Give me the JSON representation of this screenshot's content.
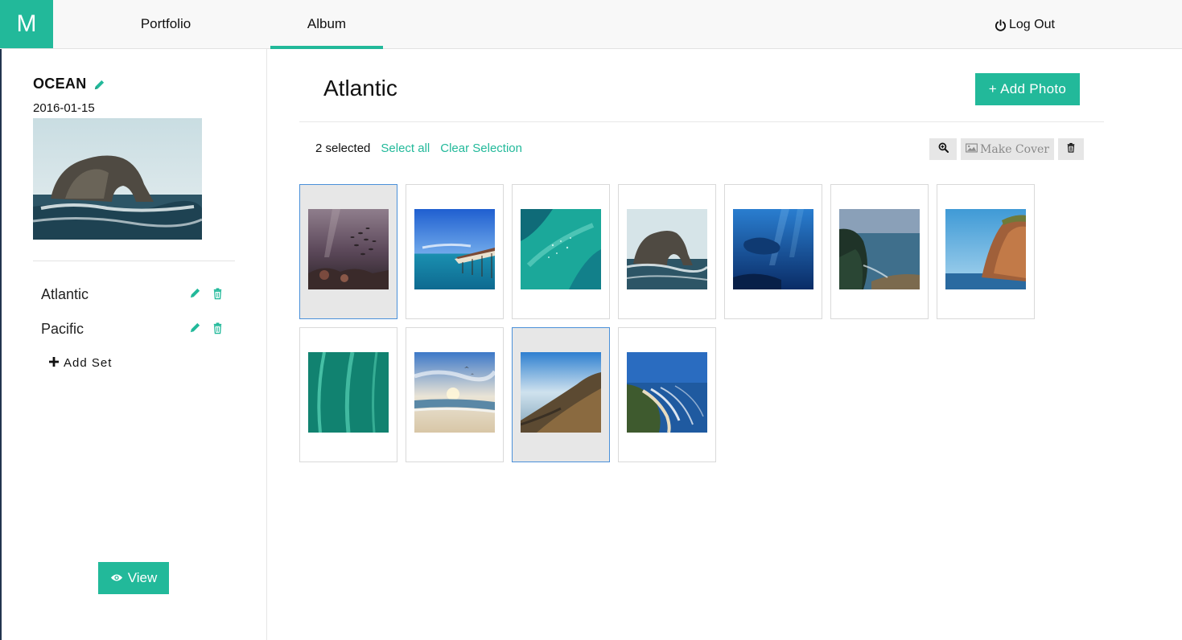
{
  "brand": {
    "logo_letter": "M"
  },
  "nav": {
    "tabs": [
      {
        "label": "Portfolio"
      },
      {
        "label": "Album",
        "active": true
      }
    ],
    "logout_label": "Log Out"
  },
  "sidebar": {
    "album_name": "OCEAN",
    "album_date": "2016-01-15",
    "cover_image": "rock-arch-ocean",
    "sets": [
      {
        "label": "Atlantic"
      },
      {
        "label": "Pacific"
      }
    ],
    "add_set_label": "Add Set",
    "view_label": "View"
  },
  "main": {
    "set_title": "Atlantic",
    "add_photo_label": "+ Add Photo",
    "selection": {
      "count_text": "2 selected",
      "select_all": "Select all",
      "clear": "Clear Selection"
    },
    "toolbar": {
      "zoom_icon": "zoom-in-icon",
      "make_cover_label": "Make Cover",
      "delete_icon": "trash-icon"
    },
    "photos": [
      {
        "subject": "underwater-fish-school",
        "selected": true
      },
      {
        "subject": "pier-over-lagoon",
        "selected": false
      },
      {
        "subject": "aerial-turquoise-water",
        "selected": false
      },
      {
        "subject": "rock-arch-ocean",
        "selected": false
      },
      {
        "subject": "underwater-whale",
        "selected": false
      },
      {
        "subject": "coastal-cliffs-bay",
        "selected": false
      },
      {
        "subject": "sea-cliff-headland",
        "selected": false
      },
      {
        "subject": "aerial-green-water-lines",
        "selected": false
      },
      {
        "subject": "beach-sunset-birds",
        "selected": false
      },
      {
        "subject": "coastal-hillside",
        "selected": true
      },
      {
        "subject": "aerial-beach-waves",
        "selected": false
      }
    ]
  },
  "colors": {
    "accent": "#22b99a",
    "topbar": "#f8f8f8",
    "selected_border": "#4a90d9",
    "selected_bg": "#e7e7e7"
  }
}
